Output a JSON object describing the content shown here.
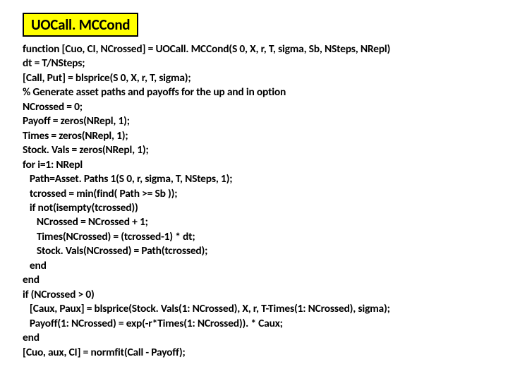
{
  "title": "UOCall. MCCond",
  "code_lines": [
    "function [Cuo, CI, NCrossed] = UOCall. MCCond(S 0, X, r, T, sigma, Sb, NSteps, NRepl)",
    "dt = T/NSteps;",
    "[Call, Put] = blsprice(S 0, X, r, T, sigma);",
    "% Generate asset paths and payoffs for the up and in option",
    "NCrossed = 0;",
    "Payoff = zeros(NRepl, 1);",
    "Times = zeros(NRepl, 1);",
    "Stock. Vals = zeros(NRepl, 1);",
    "for i=1: NRepl",
    "   Path=Asset. Paths 1(S 0, r, sigma, T, NSteps, 1);",
    "   tcrossed = min(find( Path >= Sb ));",
    "   if not(isempty(tcrossed))",
    "      NCrossed = NCrossed + 1;",
    "      Times(NCrossed) = (tcrossed-1) * dt;",
    "      Stock. Vals(NCrossed) = Path(tcrossed);",
    "   end",
    "end",
    "if (NCrossed > 0)",
    "   [Caux, Paux] = blsprice(Stock. Vals(1: NCrossed), X, r, T-Times(1: NCrossed), sigma);",
    "   Payoff(1: NCrossed) = exp(-r*Times(1: NCrossed)). * Caux;",
    "end",
    "[Cuo, aux, CI] = normfit(Call - Payoff);"
  ]
}
